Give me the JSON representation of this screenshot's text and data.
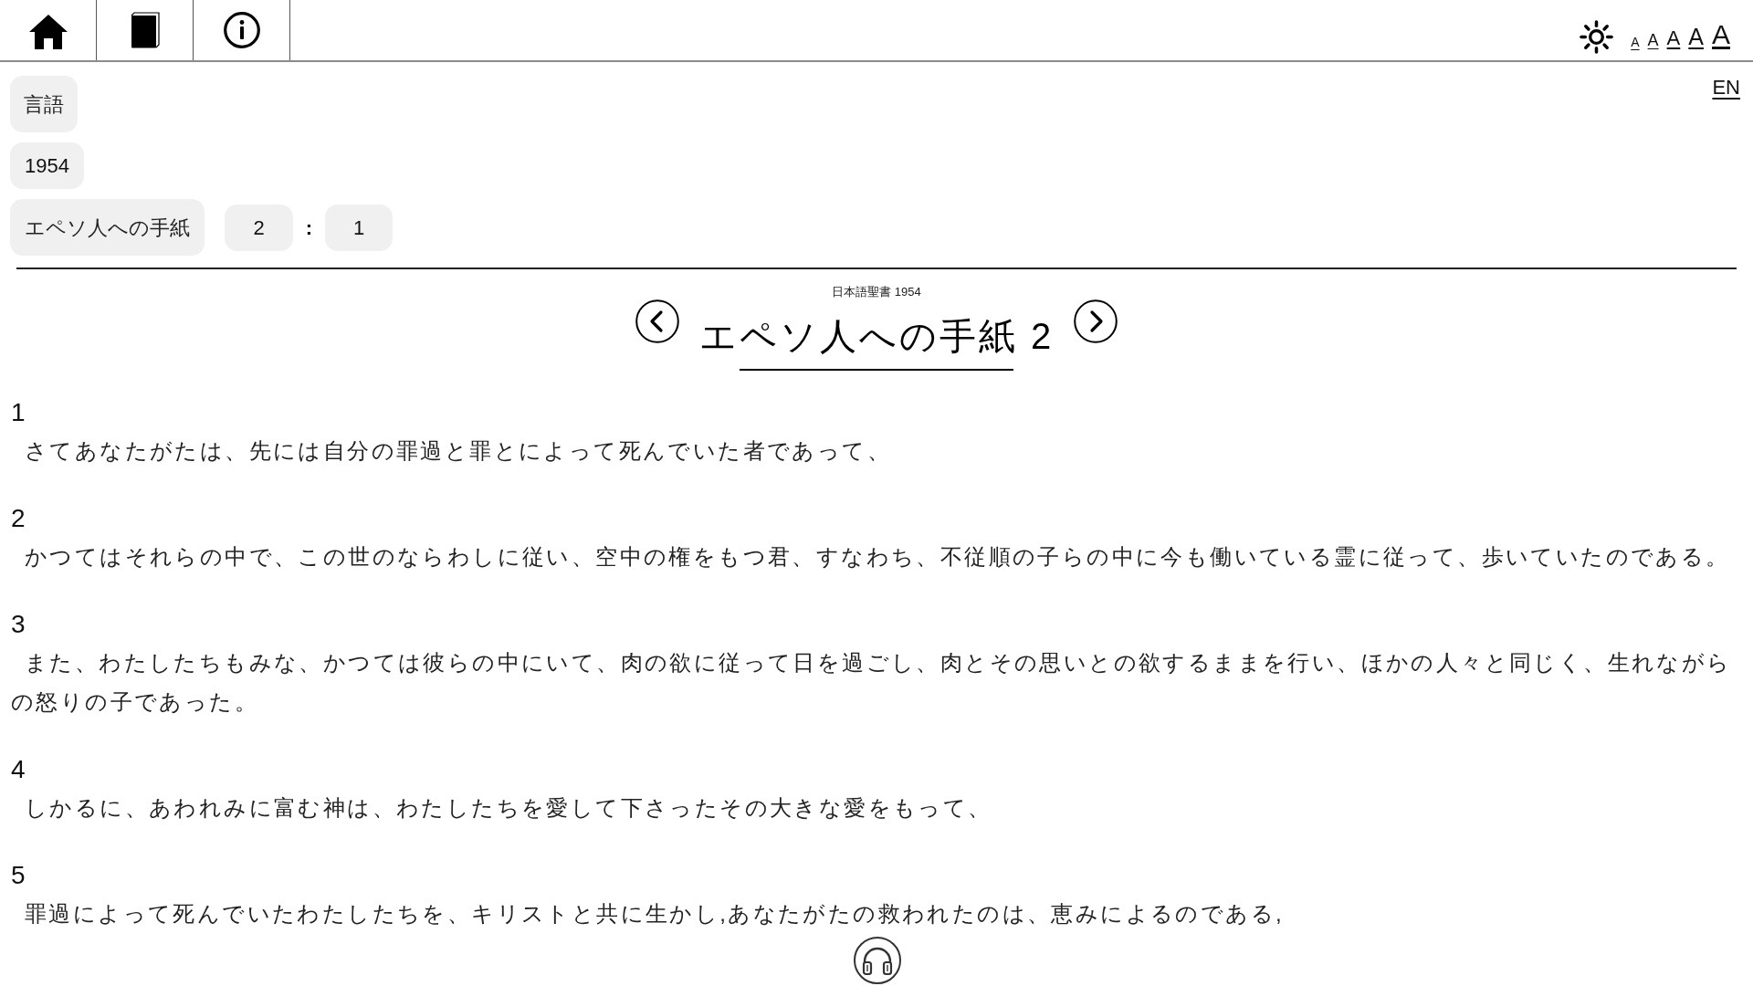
{
  "toolbar": {
    "font_size_options": [
      "A",
      "A",
      "A",
      "A",
      "A"
    ]
  },
  "language_link": "EN",
  "selectors": {
    "language": "言語",
    "version": "1954",
    "book": "エペソ人への手紙",
    "chapter": "2",
    "separator": ":",
    "verse": "1"
  },
  "chapter_header": {
    "bible_name": "日本語聖書 1954",
    "title": "エペソ人への手紙 2"
  },
  "verses": [
    {
      "number": "1",
      "text": "さてあなたがたは、先には自分の罪過と罪とによって死んでいた者であって、"
    },
    {
      "number": "2",
      "text": "かつてはそれらの中で、この世のならわしに従い、空中の権をもつ君、すなわち、不従順の子らの中に今も働いている霊に従って、歩いていたのである。"
    },
    {
      "number": "3",
      "text": "また、わたしたちもみな、かつては彼らの中にいて、肉の欲に従って日を過ごし、肉とその思いとの欲するままを行い、ほかの人々と同じく、生れながらの怒りの子であった。"
    },
    {
      "number": "4",
      "text": "しかるに、あわれみに富む神は、わたしたちを愛して下さったその大きな愛をもって、"
    },
    {
      "number": "5",
      "text": "罪過によって死んでいたわたしたちを、キリストと共に生かし,あなたがたの救われたのは、恵みによるのである,"
    }
  ]
}
